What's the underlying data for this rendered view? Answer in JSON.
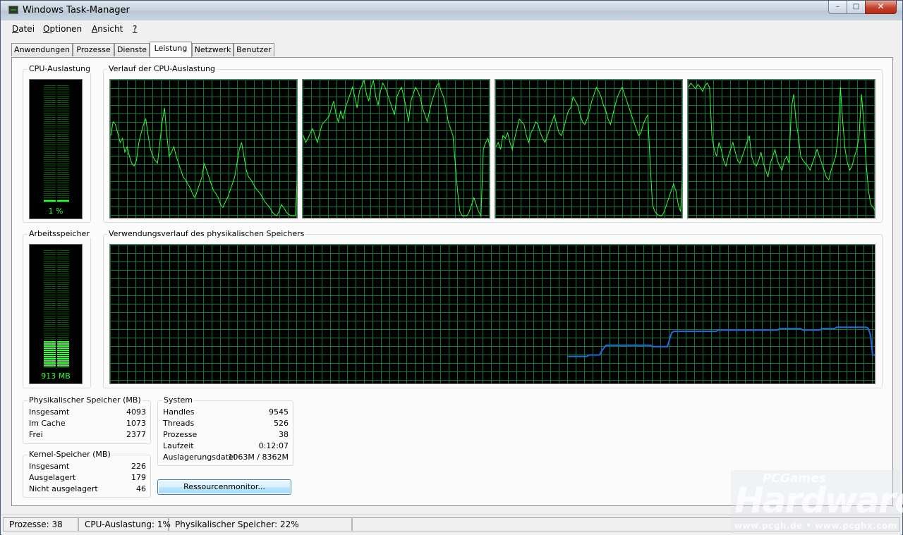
{
  "window": {
    "title": "Windows Task-Manager"
  },
  "caption_buttons": {
    "minimize": "–",
    "maximize": "□",
    "close": "✕"
  },
  "menu": [
    {
      "label": "Datei"
    },
    {
      "label": "Optionen"
    },
    {
      "label": "Ansicht"
    },
    {
      "label": "?"
    }
  ],
  "tabs": [
    {
      "label": "Anwendungen"
    },
    {
      "label": "Prozesse"
    },
    {
      "label": "Dienste"
    },
    {
      "label": "Leistung",
      "active": true
    },
    {
      "label": "Netzwerk"
    },
    {
      "label": "Benutzer"
    }
  ],
  "cpu": {
    "gauge_label": "CPU-Auslastung",
    "gauge_value": "1 %",
    "gauge_percent": 1,
    "history_label": "Verlauf der CPU-Auslastung",
    "core_history_percent": [
      [
        60,
        70,
        68,
        62,
        55,
        58,
        48,
        52,
        45,
        40,
        38,
        42,
        55,
        62,
        68,
        72,
        60,
        50,
        45,
        42,
        40,
        55,
        70,
        80,
        60,
        45,
        48,
        52,
        45,
        40,
        35,
        30,
        28,
        25,
        22,
        18,
        15,
        20,
        25,
        30,
        40,
        35,
        30,
        25,
        20,
        18,
        15,
        10,
        8,
        12,
        15,
        20,
        25,
        30,
        40,
        50,
        55,
        45,
        35,
        30,
        28,
        25,
        22,
        20,
        18,
        15,
        12,
        10,
        8,
        5,
        3,
        2,
        5,
        10,
        8,
        5,
        3,
        2,
        2,
        2,
        35
      ],
      [
        60,
        55,
        58,
        62,
        65,
        60,
        55,
        62,
        68,
        70,
        72,
        74,
        80,
        85,
        75,
        70,
        78,
        72,
        80,
        85,
        90,
        95,
        88,
        80,
        92,
        96,
        100,
        90,
        85,
        95,
        100,
        88,
        82,
        92,
        98,
        95,
        90,
        85,
        80,
        75,
        88,
        92,
        95,
        88,
        80,
        70,
        85,
        90,
        95,
        92,
        88,
        80,
        75,
        70,
        78,
        85,
        90,
        96,
        98,
        92,
        88,
        80,
        70,
        65,
        60,
        40,
        20,
        5,
        2,
        2,
        2,
        5,
        10,
        15,
        10,
        5,
        2,
        50,
        55,
        58,
        50
      ],
      [
        52,
        55,
        50,
        60,
        58,
        62,
        55,
        50,
        58,
        65,
        72,
        70,
        68,
        60,
        55,
        62,
        65,
        70,
        68,
        62,
        58,
        55,
        60,
        65,
        70,
        75,
        68,
        62,
        60,
        65,
        72,
        78,
        80,
        88,
        85,
        82,
        75,
        70,
        68,
        72,
        78,
        85,
        90,
        95,
        92,
        88,
        82,
        78,
        72,
        68,
        75,
        82,
        88,
        92,
        95,
        90,
        85,
        80,
        75,
        70,
        65,
        60,
        62,
        68,
        72,
        75,
        40,
        10,
        5,
        3,
        2,
        2,
        5,
        10,
        15,
        20,
        25,
        20,
        10,
        5,
        35
      ],
      [
        95,
        98,
        96,
        94,
        97,
        95,
        92,
        96,
        98,
        95,
        60,
        50,
        45,
        55,
        50,
        42,
        38,
        45,
        50,
        55,
        48,
        42,
        40,
        45,
        50,
        55,
        60,
        45,
        40,
        38,
        42,
        48,
        40,
        35,
        30,
        40,
        45,
        50,
        42,
        38,
        35,
        42,
        45,
        40,
        80,
        90,
        70,
        60,
        45,
        42,
        40,
        38,
        35,
        40,
        45,
        50,
        45,
        40,
        35,
        30,
        28,
        35,
        40,
        45,
        60,
        95,
        70,
        50,
        40,
        35,
        38,
        45,
        50,
        60,
        90,
        70,
        40,
        20,
        10,
        8,
        5
      ]
    ]
  },
  "memory": {
    "gauge_label": "Arbeitsspeicher",
    "gauge_value": "913 MB",
    "gauge_percent": 22,
    "history_label": "Verwendungsverlauf des physikalischen Speichers",
    "history_percent": [
      20,
      20,
      20,
      20,
      20,
      20,
      20,
      20,
      20,
      20,
      21,
      21,
      21,
      21,
      21,
      21,
      24,
      26,
      28,
      28,
      28,
      28,
      28,
      28,
      28,
      28,
      28,
      28,
      28,
      28,
      28,
      28,
      28,
      28,
      28,
      28,
      28,
      28,
      28,
      28,
      27,
      27,
      27,
      27,
      27,
      27,
      27,
      27,
      32,
      37,
      38,
      38,
      38,
      38,
      38,
      38,
      38,
      38,
      38,
      38,
      38,
      38,
      38,
      38,
      38,
      38,
      38,
      38,
      38,
      38,
      38,
      39,
      39,
      39,
      39,
      39,
      39,
      39,
      39,
      39,
      39,
      39,
      39,
      39,
      39,
      39,
      39,
      39,
      39,
      39,
      39,
      39,
      39,
      39,
      39,
      39,
      39,
      39,
      39,
      39,
      40,
      40,
      40,
      40,
      40,
      40,
      40,
      40,
      40,
      40,
      40,
      39,
      39,
      39,
      39,
      39,
      39,
      39,
      39,
      39,
      40,
      40,
      40,
      40,
      40,
      40,
      40,
      41,
      41,
      41,
      41,
      41,
      41,
      41,
      41,
      41,
      41,
      41,
      41,
      41,
      41,
      41,
      40,
      35,
      21,
      21
    ]
  },
  "physical_memory": {
    "title": "Physikalischer Speicher (MB)",
    "rows": [
      {
        "key": "Insgesamt",
        "value": "4093"
      },
      {
        "key": "Im Cache",
        "value": "1073"
      },
      {
        "key": "Frei",
        "value": "2377"
      }
    ]
  },
  "kernel_memory": {
    "title": "Kernel-Speicher (MB)",
    "rows": [
      {
        "key": "Insgesamt",
        "value": "226"
      },
      {
        "key": "Ausgelagert",
        "value": "179"
      },
      {
        "key": "Nicht ausgelagert",
        "value": "46"
      }
    ]
  },
  "system": {
    "title": "System",
    "rows": [
      {
        "key": "Handles",
        "value": "9545"
      },
      {
        "key": "Threads",
        "value": "526"
      },
      {
        "key": "Prozesse",
        "value": "38"
      },
      {
        "key": "Laufzeit",
        "value": "0:12:07"
      },
      {
        "key": "Auslagerungsdatei",
        "value": "1063M / 8362M"
      }
    ]
  },
  "resource_monitor_button": "Ressourcenmonitor...",
  "statusbar": {
    "processes": "Prozesse: 38",
    "cpu": "CPU-Auslastung: 1%",
    "memory": "Physikalischer Speicher: 22%"
  },
  "watermark": {
    "brand_top": "PCGames",
    "brand_main": "Hardware",
    "url": "www.pcgh.de • www.pcghx.com"
  },
  "colors": {
    "cpu_line": "#33ff33",
    "memory_line": "#1e6fe0",
    "grid": "#0a7a3a",
    "graph_bg": "#000000"
  }
}
